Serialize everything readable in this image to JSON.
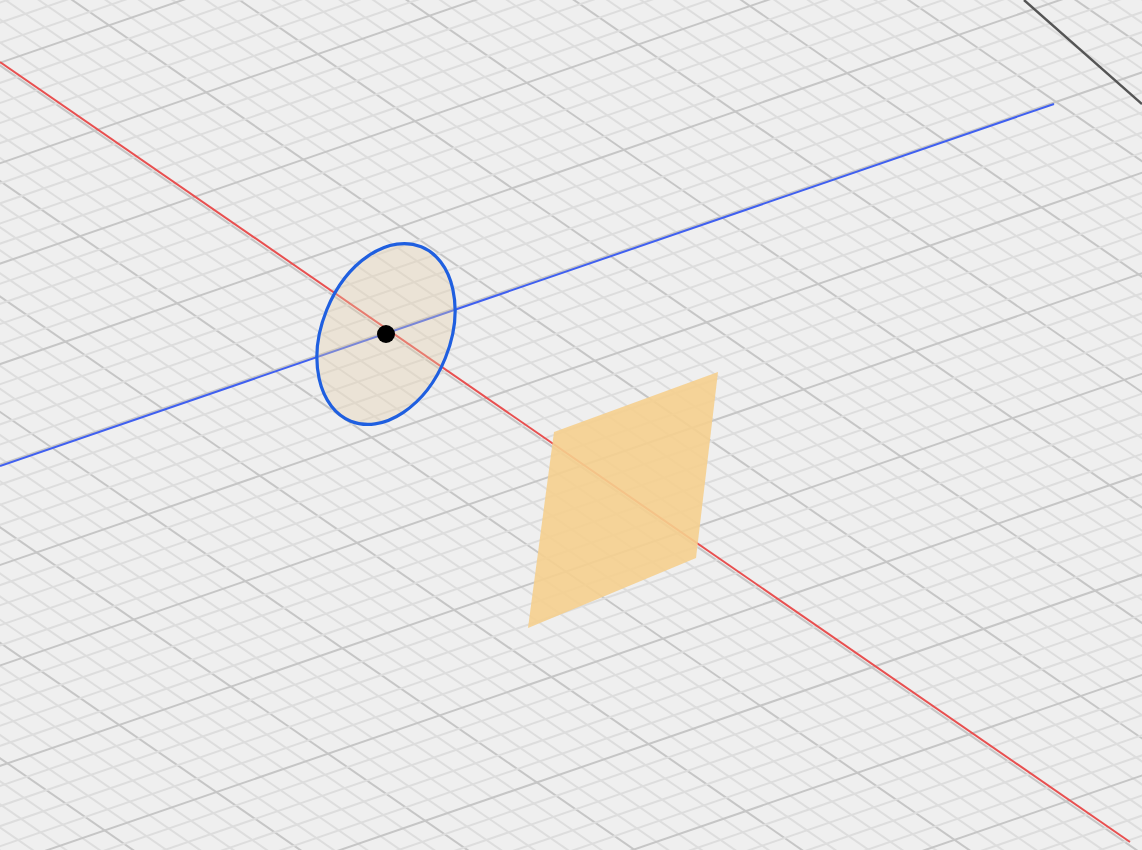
{
  "scene": {
    "objects": [
      {
        "kind": "axis",
        "color": "#e85050"
      },
      {
        "kind": "axis",
        "color": "#4060f0"
      },
      {
        "kind": "disc"
      },
      {
        "kind": "plane"
      }
    ]
  }
}
